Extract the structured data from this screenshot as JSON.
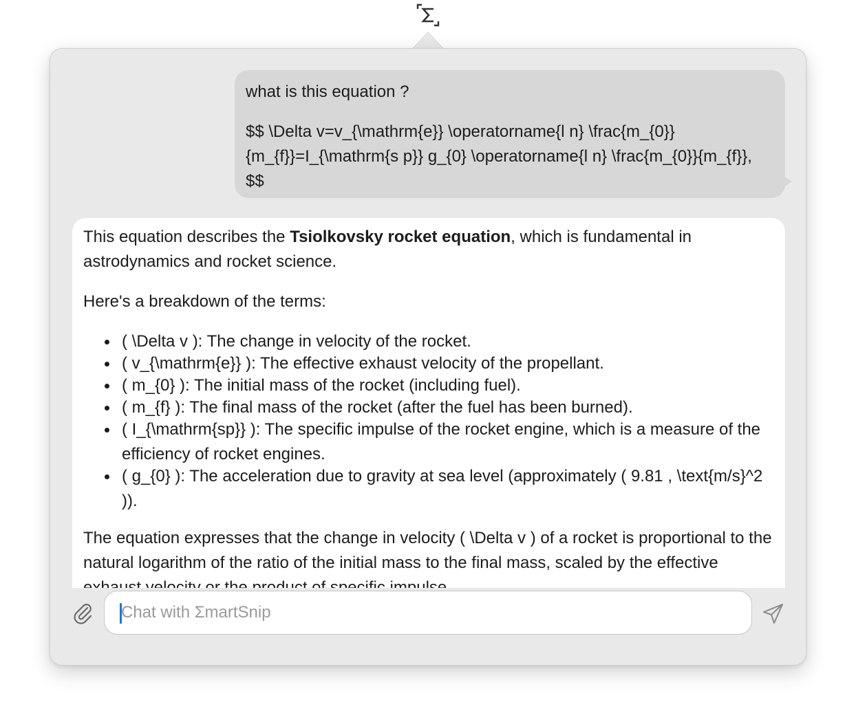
{
  "app": {
    "icon": "sigma-snip-icon"
  },
  "user_message": {
    "line1": "what is this equation ?",
    "line2": "$$ \\Delta v=v_{\\mathrm{e}} \\operatorname{l n} \\frac{m_{0}}{m_{f}}=I_{\\mathrm{s p}} g_{0} \\operatorname{l n} \\frac{m_{0}}{m_{f}}, $$"
  },
  "assistant_message": {
    "intro_before": "This equation describes the ",
    "intro_bold": "Tsiolkovsky rocket equation",
    "intro_after": ", which is fundamental in astrodynamics and rocket science.",
    "breakdown_heading": "Here's a breakdown of the terms:",
    "bullets": [
      "( \\Delta v ): The change in velocity of the rocket.",
      "( v_{\\mathrm{e}} ): The effective exhaust velocity of the propellant.",
      "( m_{0} ): The initial mass of the rocket (including fuel).",
      "( m_{f} ): The final mass of the rocket (after the fuel has been burned).",
      "( I_{\\mathrm{sp}} ): The specific impulse of the rocket engine, which is a measure of the efficiency of rocket engines.",
      "( g_{0} ): The acceleration due to gravity at sea level (approximately ( 9.81 , \\text{m/s}^2 ))."
    ],
    "conclusion": "The equation expresses that the change in velocity ( \\Delta v ) of a rocket is proportional to the natural logarithm of the ratio of the initial mass to the final mass, scaled by the effective exhaust velocity or the product of specific impulse"
  },
  "composer": {
    "placeholder": "Chat with ΣmartSnip",
    "value": "",
    "attach_icon": "paperclip-icon",
    "send_icon": "paper-plane-icon"
  },
  "colors": {
    "popover_bg": "#e9e9e9",
    "user_bubble_bg": "#d7d7d7",
    "assistant_bg": "#ffffff",
    "caret": "#1a73e8"
  }
}
